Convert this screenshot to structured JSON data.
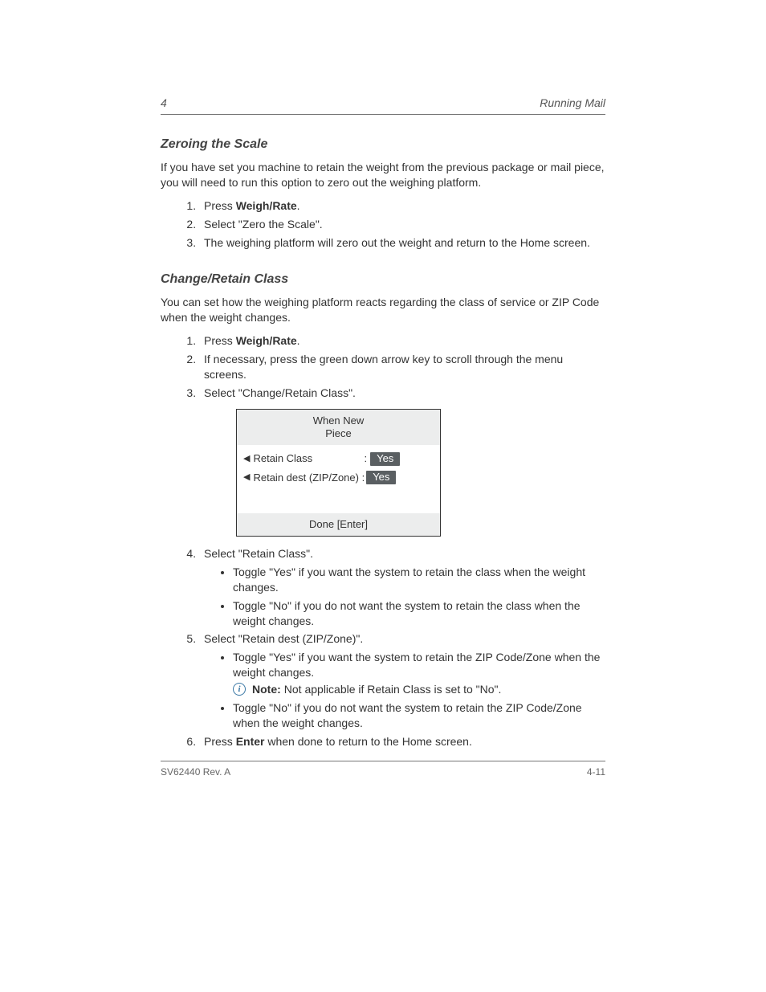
{
  "header": {
    "chapter_label": "4",
    "chapter_title": "Running Mail"
  },
  "sections": [
    {
      "title": "Zeroing the Scale",
      "intro": "If you have set you machine to retain the weight from the previous package or mail piece, you will need to run this option to zero out the weighing platform.",
      "steps": {
        "s1_a": "Press ",
        "s1_key": "Weigh/Rate",
        "s1_b": ".",
        "s2": "Select \"Zero the Scale\".",
        "s3": "The weighing platform will zero out the weight and return to the Home screen."
      }
    },
    {
      "title": "Change/Retain Class",
      "intro": "You can set how the weighing platform reacts regarding the class of service or ZIP Code when the weight changes.",
      "steps": {
        "s1_a": "Press ",
        "s1_key": "Weigh/Rate",
        "s1_b": ".",
        "s2": "If necessary, press the green down arrow key to scroll through the menu screens.",
        "s3": "Select \"Change/Retain Class\".",
        "s4": "Select \"Retain Class\".",
        "s4_b1": "Toggle \"Yes\" if you want the system to retain the class when the weight changes.",
        "s4_b2": "Toggle \"No\" if you do not want the system to retain the class when the weight changes.",
        "s5": "Select \"Retain dest (ZIP/Zone)\".",
        "s5_b1": "Toggle \"Yes\" if you want the system to retain the ZIP Code/Zone when the weight changes.",
        "note_label": "Note:",
        "s5_note": "Not applicable if Retain Class is set to \"No\".",
        "s5_b2": "Toggle \"No\" if you do not want the system to retain the ZIP Code/Zone when the weight changes.",
        "s6_a": "Press ",
        "s6_key": "Enter",
        "s6_b": " when done to return to the Home screen."
      }
    }
  ],
  "lcd": {
    "title_line1": "When New",
    "title_line2": "Piece",
    "row1_label": "Retain Class",
    "row1_value": "Yes",
    "row2_label": "Retain dest (ZIP/Zone) :",
    "row2_value": "Yes",
    "footer": "Done [Enter]"
  },
  "footer": {
    "left": "SV62440 Rev. A",
    "right": "4-11"
  }
}
